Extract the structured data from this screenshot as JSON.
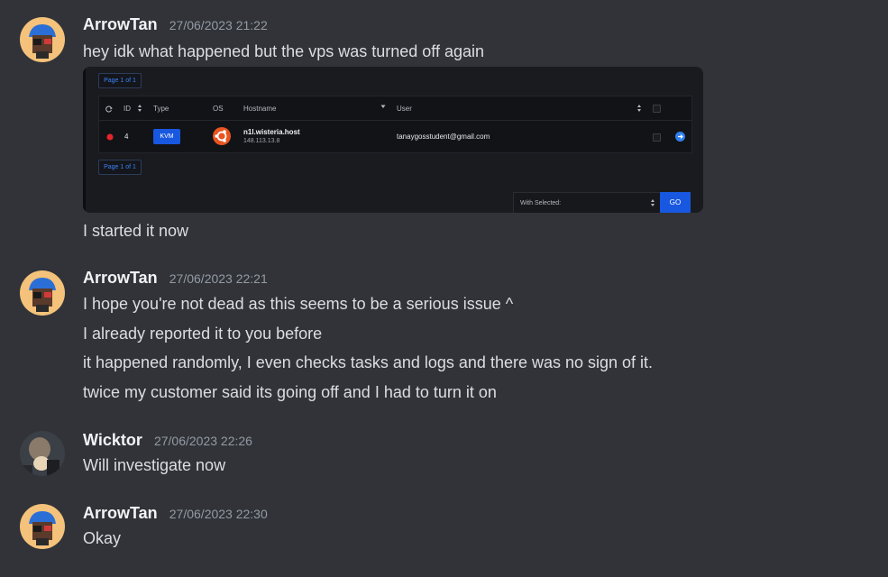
{
  "messages": [
    {
      "author": "ArrowTan",
      "timestamp": "27/06/2023 21:22",
      "lines": [
        "hey idk what happened but the vps was turned off again",
        "I started it now"
      ],
      "attachment": {
        "pager_label": "Page 1 of 1",
        "headers": {
          "id": "ID",
          "type": "Type",
          "os": "OS",
          "hostname": "Hostname",
          "user": "User"
        },
        "row": {
          "id": "4",
          "type": "KVM",
          "hostname": "n1l.wisteria.host",
          "ip": "148.113.13.8",
          "user": "tanaygosstudent@gmail.com",
          "status_color": "#e5242b"
        },
        "with_selected_label": "With Selected:",
        "go_label": "GO"
      }
    },
    {
      "author": "ArrowTan",
      "timestamp": "27/06/2023 22:21",
      "lines": [
        "I hope you're not dead as this seems to be a serious issue ^",
        "I already reported it to you before",
        "it happened randomly, I even checks tasks and logs and there was no sign of it.",
        "twice my customer said its going off and I had to turn it on"
      ]
    },
    {
      "author": "Wicktor",
      "timestamp": "27/06/2023 22:26",
      "lines": [
        "Will investigate now"
      ]
    },
    {
      "author": "ArrowTan",
      "timestamp": "27/06/2023 22:30",
      "lines": [
        "Okay"
      ]
    }
  ],
  "colors": {
    "background": "#313338",
    "text": "#dbdee1",
    "username": "#f2f3f5",
    "timestamp": "#949ba4",
    "accent_blue": "#1858e0",
    "ubuntu_orange": "#e95420"
  },
  "icons": {
    "avatar_arrowtan": "cartoon-avatar",
    "avatar_wicktor": "photo-avatar",
    "refresh": "refresh-icon",
    "sort": "sort-icon",
    "os": "ubuntu-logo-icon",
    "action": "arrow-right-circle-icon"
  }
}
